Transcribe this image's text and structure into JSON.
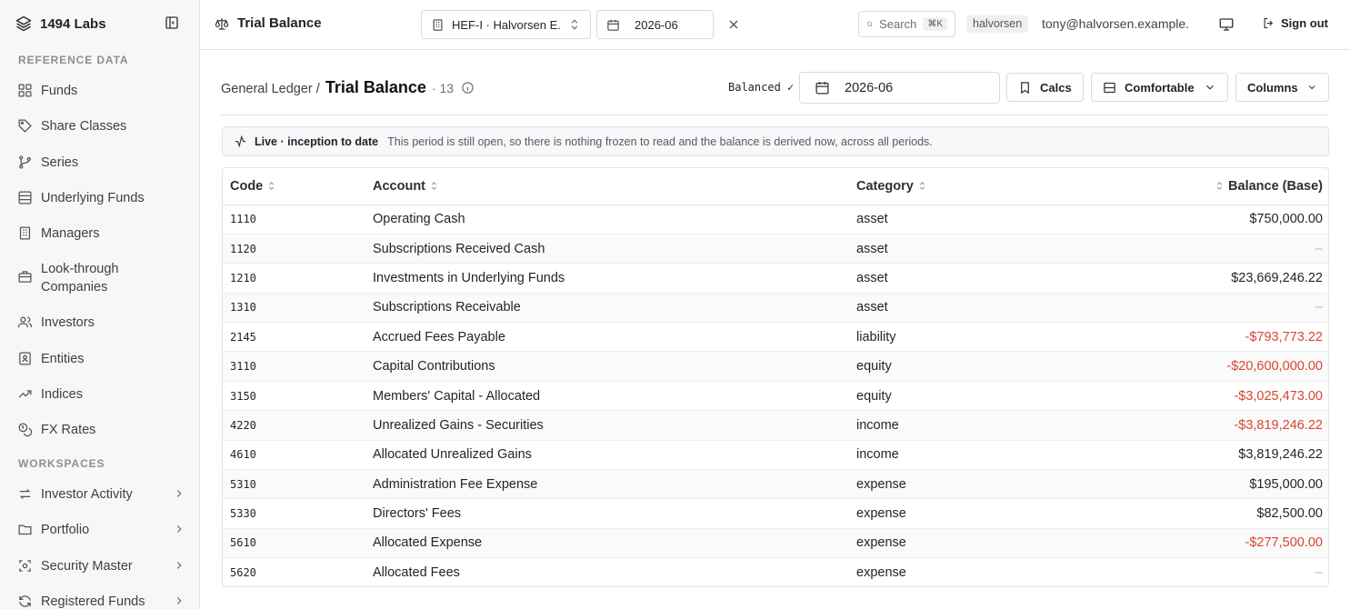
{
  "brand": {
    "name": "1494 Labs"
  },
  "sidebar": {
    "sections": {
      "reference": "REFERENCE DATA",
      "workspaces": "WORKSPACES"
    },
    "reference_items": [
      {
        "label": "Funds",
        "icon": "funds-icon"
      },
      {
        "label": "Share Classes",
        "icon": "tag-icon"
      },
      {
        "label": "Series",
        "icon": "branch-icon"
      },
      {
        "label": "Underlying Funds",
        "icon": "layers-icon"
      },
      {
        "label": "Managers",
        "icon": "building-icon"
      },
      {
        "label": "Look-through Companies",
        "icon": "briefcase-icon"
      },
      {
        "label": "Investors",
        "icon": "users-icon"
      },
      {
        "label": "Entities",
        "icon": "id-badge-icon"
      },
      {
        "label": "Indices",
        "icon": "trending-up-icon"
      },
      {
        "label": "FX Rates",
        "icon": "coins-icon"
      }
    ],
    "workspace_items": [
      {
        "label": "Investor Activity",
        "icon": "arrows-icon"
      },
      {
        "label": "Portfolio",
        "icon": "folder-icon"
      },
      {
        "label": "Security Master",
        "icon": "scan-icon"
      },
      {
        "label": "Registered Funds",
        "icon": "refresh-icon"
      }
    ]
  },
  "topbar": {
    "title": "Trial Balance",
    "fund_select": "HEF-I · Halvorsen E...",
    "date": "2026-06",
    "search_placeholder": "Search",
    "search_kbd": "⌘K",
    "tenant": "halvorsen",
    "user_email": "tony@halvorsen.example....",
    "sign_out": "Sign out"
  },
  "page": {
    "breadcrumb_parent": "General Ledger /",
    "title": "Trial Balance",
    "count": "· 13",
    "balanced": "Balanced ✓",
    "period": "2026-06",
    "calcs_label": "Calcs",
    "density_label": "Comfortable",
    "columns_label": "Columns"
  },
  "banner": {
    "label": "Live · inception to date",
    "text": "This period is still open, so there is nothing frozen to read and the balance is derived now, across all periods."
  },
  "table": {
    "headers": {
      "code": "Code",
      "account": "Account",
      "category": "Category",
      "balance": "Balance (Base)"
    },
    "rows": [
      {
        "code": "1110",
        "account": "Operating Cash",
        "category": "asset",
        "balance": "$750,000.00",
        "tone": "pos"
      },
      {
        "code": "1120",
        "account": "Subscriptions Received Cash",
        "category": "asset",
        "balance": "–",
        "tone": "dash"
      },
      {
        "code": "1210",
        "account": "Investments in Underlying Funds",
        "category": "asset",
        "balance": "$23,669,246.22",
        "tone": "pos"
      },
      {
        "code": "1310",
        "account": "Subscriptions Receivable",
        "category": "asset",
        "balance": "–",
        "tone": "dash"
      },
      {
        "code": "2145",
        "account": "Accrued Fees Payable",
        "category": "liability",
        "balance": "-$793,773.22",
        "tone": "neg"
      },
      {
        "code": "3110",
        "account": "Capital Contributions",
        "category": "equity",
        "balance": "-$20,600,000.00",
        "tone": "neg"
      },
      {
        "code": "3150",
        "account": "Members' Capital - Allocated",
        "category": "equity",
        "balance": "-$3,025,473.00",
        "tone": "neg"
      },
      {
        "code": "4220",
        "account": "Unrealized Gains - Securities",
        "category": "income",
        "balance": "-$3,819,246.22",
        "tone": "neg"
      },
      {
        "code": "4610",
        "account": "Allocated Unrealized Gains",
        "category": "income",
        "balance": "$3,819,246.22",
        "tone": "pos"
      },
      {
        "code": "5310",
        "account": "Administration Fee Expense",
        "category": "expense",
        "balance": "$195,000.00",
        "tone": "pos"
      },
      {
        "code": "5330",
        "account": "Directors' Fees",
        "category": "expense",
        "balance": "$82,500.00",
        "tone": "pos"
      },
      {
        "code": "5610",
        "account": "Allocated Expense",
        "category": "expense",
        "balance": "-$277,500.00",
        "tone": "neg"
      },
      {
        "code": "5620",
        "account": "Allocated Fees",
        "category": "expense",
        "balance": "–",
        "tone": "dash"
      }
    ]
  }
}
